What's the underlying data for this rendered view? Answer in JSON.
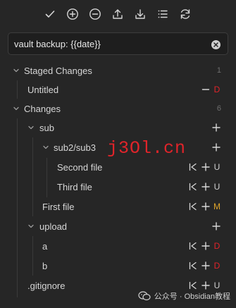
{
  "toolbar": {
    "buttons": [
      {
        "icon": "commit-check-icon"
      },
      {
        "icon": "stage-all-plus-icon"
      },
      {
        "icon": "unstage-all-minus-icon"
      },
      {
        "icon": "push-upload-icon"
      },
      {
        "icon": "pull-download-icon"
      },
      {
        "icon": "list-view-icon"
      },
      {
        "icon": "refresh-icon"
      }
    ]
  },
  "commit": {
    "message": "vault backup: {{date}}"
  },
  "staged": {
    "title": "Staged Changes",
    "count": "1",
    "files": [
      {
        "name": "Untitled",
        "status": "D"
      }
    ]
  },
  "changes": {
    "title": "Changes",
    "count": "6",
    "folder_sub": "sub",
    "folder_sub2": "sub2/sub3",
    "second_file": "Second file",
    "second_status": "U",
    "third_file": "Third file",
    "third_status": "U",
    "first_file": "First file",
    "first_status": "M",
    "folder_upload": "upload",
    "file_a": "a",
    "file_a_status": "D",
    "file_b": "b",
    "file_b_status": "D",
    "gitignore": ".gitignore",
    "gitignore_status": "U"
  },
  "overlay": {
    "watermark": "j3Ol.cn",
    "wechat_text": "公众号 · Obsidian教程"
  },
  "colors": {
    "background": "#262626",
    "deleted": "#e0242a",
    "modified": "#e0a52b",
    "untracked": "#cfcfcf"
  }
}
